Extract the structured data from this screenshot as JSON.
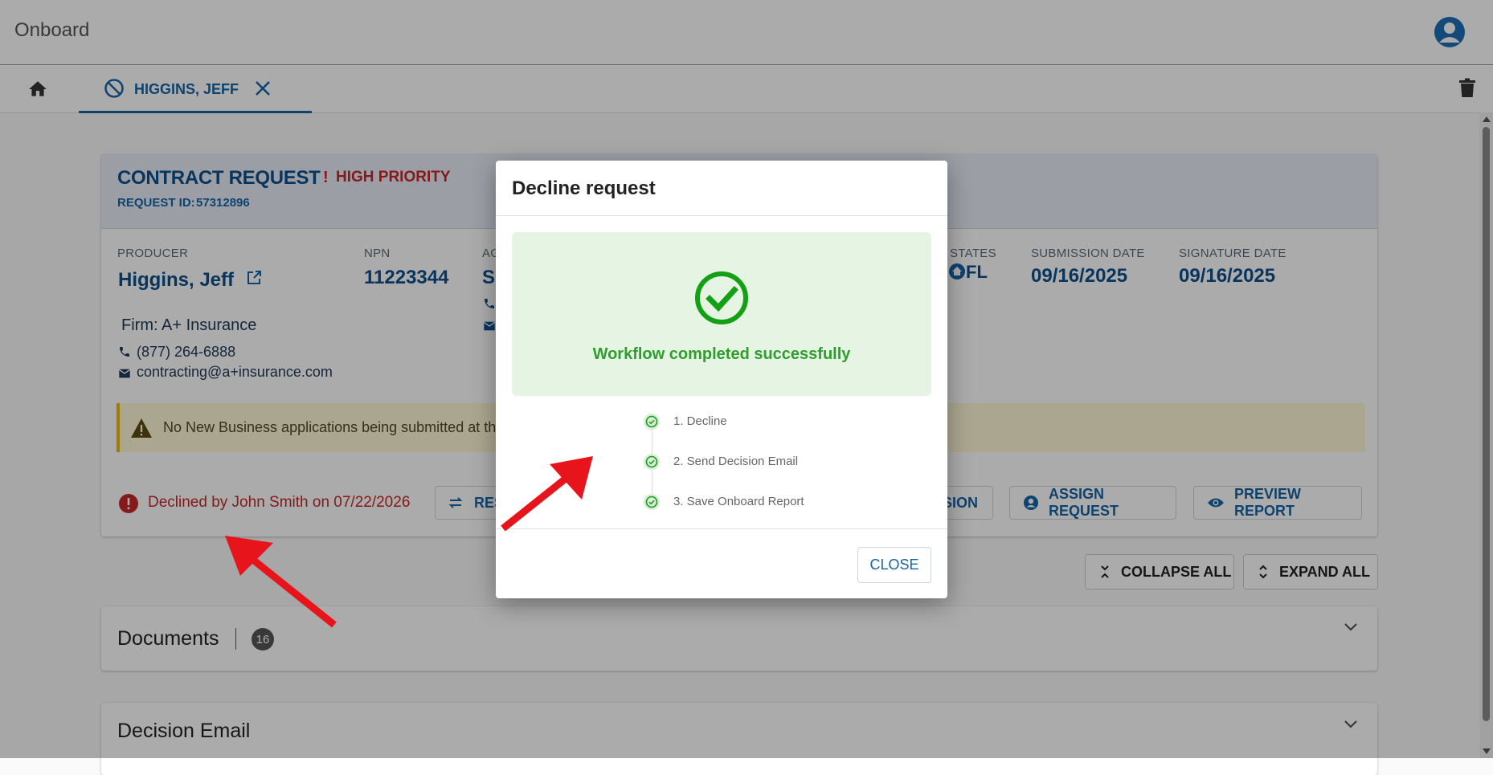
{
  "app": {
    "title": "Onboard"
  },
  "tabs": {
    "active_label": "HIGGINS, JEFF"
  },
  "card": {
    "title": "CONTRACT REQUEST",
    "priority": "HIGH PRIORITY",
    "request_id_label": "REQUEST ID:",
    "request_id": "57312896",
    "producer_label": "PRODUCER",
    "producer_name": "Higgins, Jeff",
    "npn_label": "NPN",
    "npn": "11223344",
    "ag_label": "AG",
    "ag_value": "Su",
    "states_label": "STATES",
    "state": "FL",
    "submission_label": "SUBMISSION DATE",
    "submission_date": "09/16/2025",
    "signature_label": "SIGNATURE DATE",
    "signature_date": "09/16/2025",
    "firm": "Firm: A+ Insurance",
    "phone": "(877) 264-6888",
    "email": "contracting@a+insurance.com",
    "warning": "No New Business applications being submitted at the",
    "declined": "Declined by John Smith on 07/22/2026",
    "buttons": {
      "reset_partial": "RES",
      "decision_partial": "SION",
      "assign": "ASSIGN REQUEST",
      "preview": "PREVIEW REPORT"
    }
  },
  "controls": {
    "collapse_all": "COLLAPSE ALL",
    "expand_all": "EXPAND ALL"
  },
  "sections": [
    {
      "title": "Documents",
      "count": "16"
    },
    {
      "title": "Decision Email"
    }
  ],
  "dialog": {
    "title": "Decline request",
    "success_message": "Workflow completed successfully",
    "steps": [
      "1. Decline",
      "2. Send Decision Email",
      "3. Save Onboard Report"
    ],
    "close_label": "CLOSE"
  },
  "colors": {
    "primary": "#1565a8",
    "danger": "#c62828",
    "success": "#2e9e2e",
    "annotation": "#e8141c"
  }
}
